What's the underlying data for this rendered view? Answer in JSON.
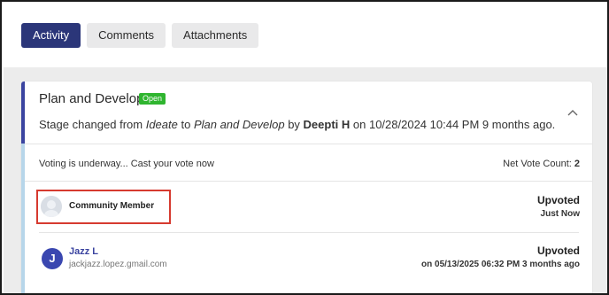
{
  "tabs": [
    {
      "label": "Activity",
      "active": true
    },
    {
      "label": "Comments",
      "active": false
    },
    {
      "label": "Attachments",
      "active": false
    }
  ],
  "card": {
    "title": "Plan and Develop",
    "badge": "Open",
    "stage": {
      "prefix": "Stage changed from ",
      "from": "Ideate",
      "to_word": " to ",
      "to": "Plan and Develop",
      "by_word": " by ",
      "user": "Deepti H",
      "suffix": " on 10/28/2024 10:44 PM 9 months ago."
    }
  },
  "voting": {
    "status_text": "Voting is underway... Cast your vote now",
    "net_label": "Net Vote Count: ",
    "net_value": "2"
  },
  "votes": [
    {
      "name": "Community Member",
      "status": "Upvoted",
      "time": "Just Now"
    },
    {
      "initial": "J",
      "name": "Jazz L",
      "email": "jackjazz.lopez.gmail.com",
      "status": "Upvoted",
      "time": "on 05/13/2025 06:32 PM 3 months ago"
    }
  ],
  "colors": {
    "accent": "#2b3679",
    "badge": "#2fb52f",
    "highlight": "#d63a2f",
    "link": "#3b44a0"
  }
}
